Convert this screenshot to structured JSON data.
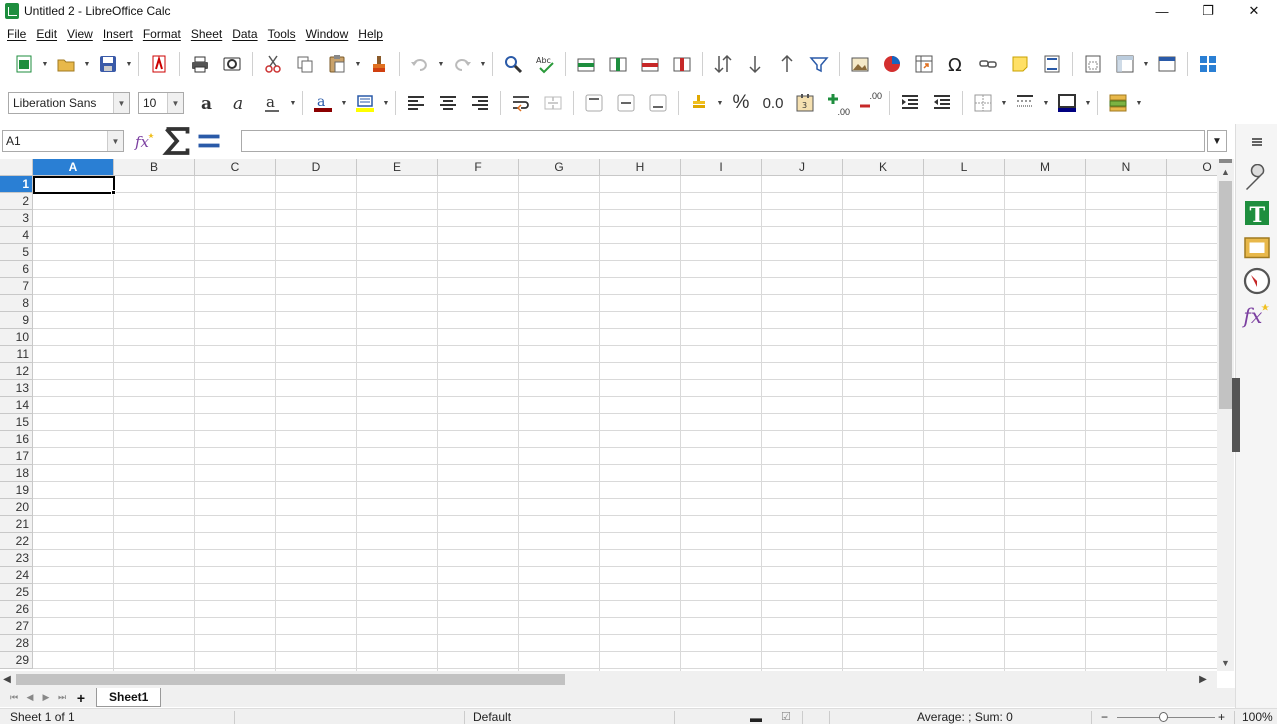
{
  "window": {
    "title": "Untitled 2 - LibreOffice Calc",
    "controls": [
      "—",
      "❐",
      "✕"
    ]
  },
  "menu": [
    "File",
    "Edit",
    "View",
    "Insert",
    "Format",
    "Sheet",
    "Data",
    "Tools",
    "Window",
    "Help"
  ],
  "format_toolbar": {
    "font_name": "Liberation Sans",
    "font_size": "10",
    "percent_label": "%",
    "number_label": "0.0",
    "add_decimal_label": ".00",
    "del_decimal_label": ".00"
  },
  "formula_bar": {
    "name_box": "A1",
    "formula": ""
  },
  "grid": {
    "columns": [
      "A",
      "B",
      "C",
      "D",
      "E",
      "F",
      "G",
      "H",
      "I",
      "J",
      "K",
      "L",
      "M",
      "N",
      "O"
    ],
    "rows": [
      "1",
      "2",
      "3",
      "4",
      "5",
      "6",
      "7",
      "8",
      "9",
      "10",
      "11",
      "12",
      "13",
      "14",
      "15",
      "16",
      "17",
      "18",
      "19",
      "20",
      "21",
      "22",
      "23",
      "24",
      "25",
      "26",
      "27",
      "28",
      "29"
    ],
    "active_column": "A",
    "active_row": "1"
  },
  "tabs": {
    "add_label": "+",
    "sheets": [
      "Sheet1"
    ]
  },
  "status": {
    "sheet_info": "Sheet 1 of 1",
    "page_style": "Default",
    "summary": "Average: ; Sum: 0",
    "zoom": "100%"
  },
  "colors": {
    "accent": "#2a7fd4",
    "font_color": "#8b0000",
    "highlight": "#ffff00",
    "border_color": "#000080",
    "calc_green": "#1e8e3e"
  }
}
